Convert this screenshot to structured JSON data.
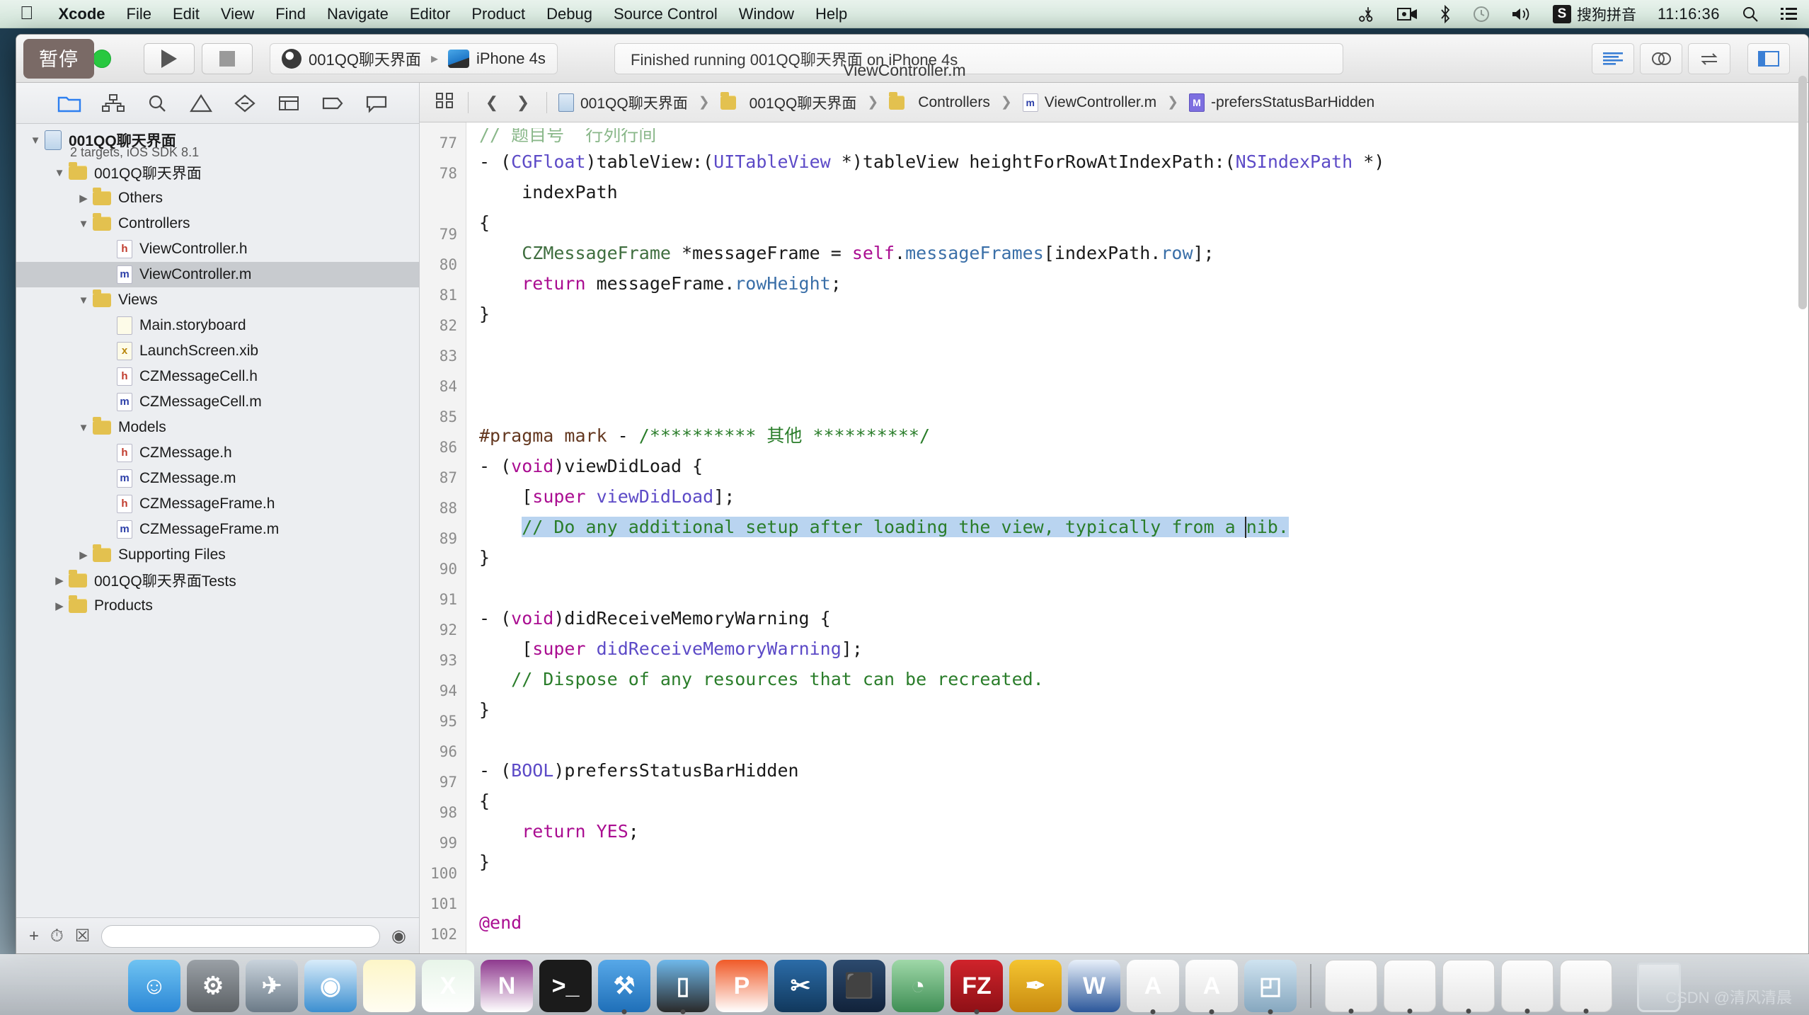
{
  "menubar": {
    "apple_icon": "apple-icon",
    "items": [
      "Xcode",
      "File",
      "Edit",
      "View",
      "Find",
      "Navigate",
      "Editor",
      "Product",
      "Debug",
      "Source Control",
      "Window",
      "Help"
    ],
    "right_icons": [
      "scissors-icon",
      "screen-record-icon",
      "bluetooth-icon",
      "timemachine-icon",
      "volume-icon"
    ],
    "ime_badge": "S",
    "ime_name": "搜狗拼音",
    "clock": "11:16:36",
    "search_icon": "search-icon",
    "notification_icon": "notification-center-icon"
  },
  "toolbar": {
    "pause_tooltip": "暂停",
    "run_icon": "play-icon",
    "stop_icon": "stop-icon",
    "scheme_project": "001QQ聊天界面",
    "scheme_destination": "iPhone 4s",
    "status_text": "Finished running 001QQ聊天界面 on iPhone 4s",
    "right_buttons": [
      "standard-editor-icon",
      "assistant-editor-icon",
      "version-editor-icon",
      "navigator-toggle-icon"
    ]
  },
  "window": {
    "title": "ViewController.m"
  },
  "navigator": {
    "tabs": [
      "project-navigator-icon",
      "symbol-navigator-icon",
      "find-navigator-icon",
      "issue-navigator-icon",
      "test-navigator-icon",
      "debug-navigator-icon",
      "breakpoint-navigator-icon",
      "report-navigator-icon"
    ],
    "tree": [
      {
        "label": "001QQ聊天界面",
        "sub": "2 targets, iOS SDK 8.1",
        "depth": 0,
        "kind": "project",
        "twisty": "down",
        "bold": true,
        "selected": false
      },
      {
        "label": "001QQ聊天界面",
        "depth": 1,
        "kind": "folder",
        "twisty": "down",
        "selected": false
      },
      {
        "label": "Others",
        "depth": 2,
        "kind": "folder",
        "twisty": "right",
        "selected": false
      },
      {
        "label": "Controllers",
        "depth": 2,
        "kind": "folder",
        "twisty": "down",
        "selected": false
      },
      {
        "label": "ViewController.h",
        "depth": 3,
        "kind": "h",
        "twisty": "none",
        "selected": false
      },
      {
        "label": "ViewController.m",
        "depth": 3,
        "kind": "m",
        "twisty": "none",
        "selected": true
      },
      {
        "label": "Views",
        "depth": 2,
        "kind": "folder",
        "twisty": "down",
        "selected": false
      },
      {
        "label": "Main.storyboard",
        "depth": 3,
        "kind": "sb",
        "twisty": "none",
        "selected": false
      },
      {
        "label": "LaunchScreen.xib",
        "depth": 3,
        "kind": "xib",
        "twisty": "none",
        "selected": false
      },
      {
        "label": "CZMessageCell.h",
        "depth": 3,
        "kind": "h",
        "twisty": "none",
        "selected": false
      },
      {
        "label": "CZMessageCell.m",
        "depth": 3,
        "kind": "m",
        "twisty": "none",
        "selected": false
      },
      {
        "label": "Models",
        "depth": 2,
        "kind": "folder",
        "twisty": "down",
        "selected": false
      },
      {
        "label": "CZMessage.h",
        "depth": 3,
        "kind": "h",
        "twisty": "none",
        "selected": false
      },
      {
        "label": "CZMessage.m",
        "depth": 3,
        "kind": "m",
        "twisty": "none",
        "selected": false
      },
      {
        "label": "CZMessageFrame.h",
        "depth": 3,
        "kind": "h",
        "twisty": "none",
        "selected": false
      },
      {
        "label": "CZMessageFrame.m",
        "depth": 3,
        "kind": "m",
        "twisty": "none",
        "selected": false
      },
      {
        "label": "Supporting Files",
        "depth": 2,
        "kind": "folder",
        "twisty": "right",
        "selected": false
      },
      {
        "label": "001QQ聊天界面Tests",
        "depth": 1,
        "kind": "folder",
        "twisty": "right",
        "selected": false
      },
      {
        "label": "Products",
        "depth": 1,
        "kind": "folder",
        "twisty": "right",
        "selected": false
      }
    ],
    "bottom_bar": {
      "add_icon": "add-icon",
      "recent_icon": "recent-files-icon",
      "sourcecontrol_icon": "source-control-filter-icon",
      "filter_icon": "filter-icon",
      "filter_placeholder": ""
    }
  },
  "jumpbar": {
    "related_icon": "related-items-icon",
    "back_icon": "chevron-left-icon",
    "forward_icon": "chevron-right-icon",
    "crumbs": [
      {
        "label": "001QQ聊天界面",
        "icon": "project-icon"
      },
      {
        "label": "001QQ聊天界面",
        "icon": "folder-icon"
      },
      {
        "label": "Controllers",
        "icon": "folder-icon"
      },
      {
        "label": "ViewController.m",
        "icon": "m-file-icon"
      },
      {
        "label": "-prefersStatusBarHidden",
        "icon": "method-icon"
      }
    ]
  },
  "editor": {
    "first_line_number": 77,
    "lines": [
      {
        "n": 77,
        "segs": [
          {
            "t": "// ",
            "c": "cm"
          },
          {
            "t": "题目号  行列行间",
            "c": "cm"
          }
        ],
        "partial": true
      },
      {
        "n": 78,
        "segs": [
          {
            "t": "- (",
            "c": ""
          },
          {
            "t": "CGFloat",
            "c": "ty"
          },
          {
            "t": ")tableView:(",
            "c": ""
          },
          {
            "t": "UITableView",
            "c": "ty"
          },
          {
            "t": " *)tableView heightForRowAtIndexPath:(",
            "c": ""
          },
          {
            "t": "NSIndexPath",
            "c": "ty"
          },
          {
            "t": " *)",
            "c": ""
          }
        ]
      },
      {
        "n": null,
        "segs": [
          {
            "t": "    indexPath",
            "c": ""
          }
        ]
      },
      {
        "n": 79,
        "segs": [
          {
            "t": "{",
            "c": ""
          }
        ]
      },
      {
        "n": 80,
        "segs": [
          {
            "t": "    ",
            "c": ""
          },
          {
            "t": "CZMessageFrame",
            "c": "cls"
          },
          {
            "t": " *messageFrame = ",
            "c": ""
          },
          {
            "t": "self",
            "c": "kw"
          },
          {
            "t": ".",
            "c": ""
          },
          {
            "t": "messageFrames",
            "c": "prop"
          },
          {
            "t": "[indexPath.",
            "c": ""
          },
          {
            "t": "row",
            "c": "prop"
          },
          {
            "t": "];",
            "c": ""
          }
        ]
      },
      {
        "n": 81,
        "segs": [
          {
            "t": "    ",
            "c": ""
          },
          {
            "t": "return",
            "c": "kw"
          },
          {
            "t": " messageFrame.",
            "c": ""
          },
          {
            "t": "rowHeight",
            "c": "prop"
          },
          {
            "t": ";",
            "c": ""
          }
        ]
      },
      {
        "n": 82,
        "segs": [
          {
            "t": "}",
            "c": ""
          }
        ]
      },
      {
        "n": 83,
        "segs": [
          {
            "t": "",
            "c": ""
          }
        ]
      },
      {
        "n": 84,
        "segs": [
          {
            "t": "",
            "c": ""
          }
        ]
      },
      {
        "n": 85,
        "segs": [
          {
            "t": "",
            "c": ""
          }
        ]
      },
      {
        "n": 86,
        "segs": [
          {
            "t": "#pragma mark",
            "c": "pp"
          },
          {
            "t": " - ",
            "c": ""
          },
          {
            "t": "/********** 其他 **********/",
            "c": "cm"
          }
        ]
      },
      {
        "n": 87,
        "segs": [
          {
            "t": "- (",
            "c": ""
          },
          {
            "t": "void",
            "c": "kw"
          },
          {
            "t": ")viewDidLoad {",
            "c": ""
          }
        ]
      },
      {
        "n": 88,
        "segs": [
          {
            "t": "    [",
            "c": ""
          },
          {
            "t": "super",
            "c": "kw"
          },
          {
            "t": " ",
            "c": ""
          },
          {
            "t": "viewDidLoad",
            "c": "ty"
          },
          {
            "t": "];",
            "c": ""
          }
        ]
      },
      {
        "n": 89,
        "segs": [
          {
            "t": "    ",
            "c": ""
          },
          {
            "t": "// Do any additional setup after loading the view, typically from a nib.",
            "c": "cm",
            "hl": true
          }
        ]
      },
      {
        "n": 90,
        "segs": [
          {
            "t": "}",
            "c": ""
          }
        ]
      },
      {
        "n": 91,
        "segs": [
          {
            "t": "",
            "c": ""
          }
        ]
      },
      {
        "n": 92,
        "segs": [
          {
            "t": "- (",
            "c": ""
          },
          {
            "t": "void",
            "c": "kw"
          },
          {
            "t": ")didReceiveMemoryWarning {",
            "c": ""
          }
        ]
      },
      {
        "n": 93,
        "segs": [
          {
            "t": "    [",
            "c": ""
          },
          {
            "t": "super",
            "c": "kw"
          },
          {
            "t": " ",
            "c": ""
          },
          {
            "t": "didReceiveMemoryWarning",
            "c": "ty"
          },
          {
            "t": "];",
            "c": ""
          }
        ]
      },
      {
        "n": 94,
        "segs": [
          {
            "t": "   ",
            "c": ""
          },
          {
            "t": "// Dispose of any resources that can be recreated.",
            "c": "cm"
          }
        ]
      },
      {
        "n": 95,
        "segs": [
          {
            "t": "}",
            "c": ""
          }
        ]
      },
      {
        "n": 96,
        "segs": [
          {
            "t": "",
            "c": ""
          }
        ]
      },
      {
        "n": 97,
        "segs": [
          {
            "t": "- (",
            "c": ""
          },
          {
            "t": "BOOL",
            "c": "ty"
          },
          {
            "t": ")prefersStatusBarHidden",
            "c": ""
          }
        ]
      },
      {
        "n": 98,
        "segs": [
          {
            "t": "{",
            "c": ""
          }
        ]
      },
      {
        "n": 99,
        "segs": [
          {
            "t": "    ",
            "c": ""
          },
          {
            "t": "return",
            "c": "kw"
          },
          {
            "t": " ",
            "c": ""
          },
          {
            "t": "YES",
            "c": "kw"
          },
          {
            "t": ";",
            "c": ""
          }
        ]
      },
      {
        "n": 100,
        "segs": [
          {
            "t": "}",
            "c": ""
          }
        ]
      },
      {
        "n": 101,
        "segs": [
          {
            "t": "",
            "c": ""
          }
        ]
      },
      {
        "n": 102,
        "segs": [
          {
            "t": "@end",
            "c": "kw"
          }
        ]
      }
    ]
  },
  "dock": {
    "items": [
      {
        "name": "finder",
        "glyph": "☺",
        "bg": "linear-gradient(180deg,#6fc3f2,#2b87d6)",
        "running": false
      },
      {
        "name": "system-preferences",
        "glyph": "⚙",
        "bg": "linear-gradient(180deg,#9aa0a6,#5b6064)",
        "running": false
      },
      {
        "name": "launchpad",
        "glyph": "✈",
        "bg": "linear-gradient(180deg,#c9d3dc,#6b7a87)",
        "running": false
      },
      {
        "name": "safari",
        "glyph": "◉",
        "bg": "linear-gradient(180deg,#d8ecfa,#3c8fd0)",
        "running": false
      },
      {
        "name": "notes",
        "glyph": "",
        "bg": "linear-gradient(180deg,#fdf6c8,#fffdf2)",
        "running": false
      },
      {
        "name": "excel",
        "glyph": "X",
        "bg": "linear-gradient(180deg,#e8f5e9,#ffffff)",
        "running": false
      },
      {
        "name": "onenote",
        "glyph": "N",
        "bg": "linear-gradient(180deg,#8e3a8e,#fff)",
        "running": false
      },
      {
        "name": "terminal",
        "glyph": ">_",
        "bg": "#1b1b1b",
        "running": false
      },
      {
        "name": "xcode",
        "glyph": "⚒",
        "bg": "linear-gradient(180deg,#57a8e8,#1f6fb8)",
        "running": true
      },
      {
        "name": "ios-simulator",
        "glyph": "▯",
        "bg": "linear-gradient(180deg,#6fb8ea,#2a2a2a)",
        "running": true
      },
      {
        "name": "pdf-tool",
        "glyph": "P",
        "bg": "linear-gradient(180deg,#f05a28,#ffffff)",
        "running": false
      },
      {
        "name": "snipping-tool",
        "glyph": "✂",
        "bg": "linear-gradient(180deg,#2b6ca8,#11385c)",
        "running": false
      },
      {
        "name": "imovie",
        "glyph": "⬛",
        "bg": "linear-gradient(180deg,#2c4a6e,#11223a)",
        "running": false
      },
      {
        "name": "photos",
        "glyph": "◔",
        "bg": "linear-gradient(180deg,#9fd8a8,#3e8e54)",
        "running": false
      },
      {
        "name": "filezilla",
        "glyph": "FZ",
        "bg": "linear-gradient(180deg,#d0232b,#8e1016)",
        "running": true
      },
      {
        "name": "illustrator",
        "glyph": "✒",
        "bg": "linear-gradient(180deg,#f4c430,#c98b10)",
        "running": false
      },
      {
        "name": "word",
        "glyph": "W",
        "bg": "linear-gradient(180deg,#e8f0fa,#2b579a)",
        "running": false
      },
      {
        "name": "document-a1",
        "glyph": "A",
        "bg": "linear-gradient(180deg,#fdfdfd,#e2e2e2)",
        "running": true
      },
      {
        "name": "document-a2",
        "glyph": "A",
        "bg": "linear-gradient(180deg,#fdfdfd,#e2e2e2)",
        "running": true
      },
      {
        "name": "preview",
        "glyph": "◰",
        "bg": "linear-gradient(180deg,#cfe3f0,#86a7bf)",
        "running": true
      }
    ],
    "minimized": [
      {
        "name": "minimized-window-1",
        "running": true
      },
      {
        "name": "minimized-window-2",
        "running": true
      },
      {
        "name": "minimized-window-3",
        "running": true
      },
      {
        "name": "minimized-window-4",
        "running": true
      },
      {
        "name": "minimized-window-5",
        "running": true
      }
    ],
    "trash": "trash-icon"
  },
  "watermark": "CSDN @清风清晨"
}
